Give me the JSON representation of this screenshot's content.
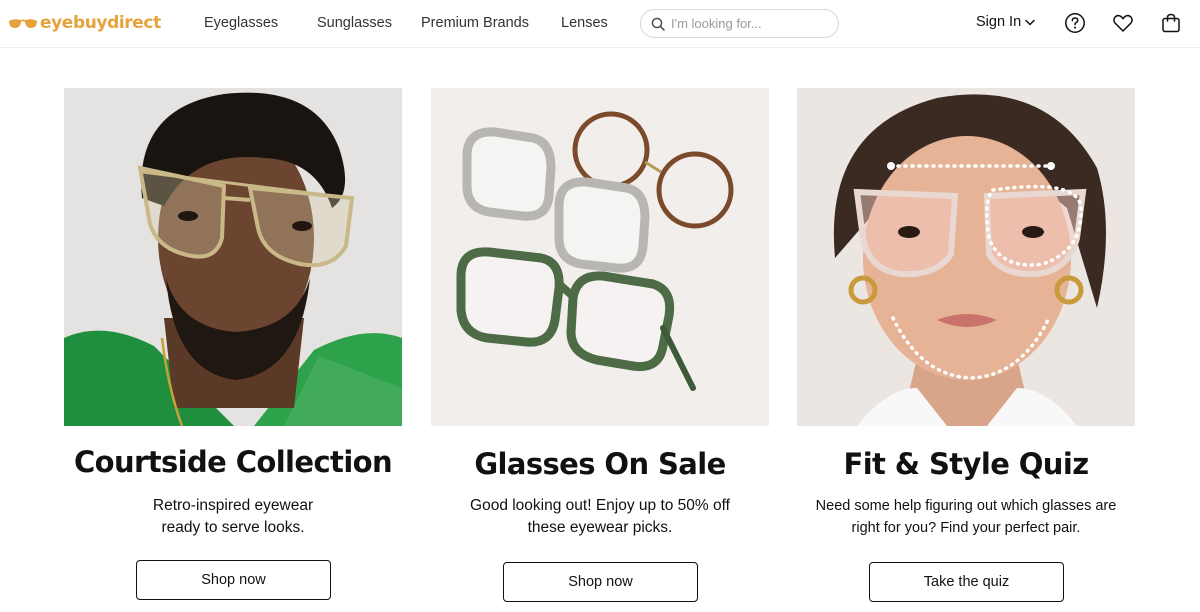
{
  "brand": {
    "logo_text": "eyebuydirect",
    "accent": "#e6a23c"
  },
  "nav": {
    "items": [
      {
        "label": "Eyeglasses"
      },
      {
        "label": "Sunglasses"
      },
      {
        "label": "Premium Brands"
      },
      {
        "label": "Lenses"
      }
    ]
  },
  "search": {
    "placeholder": "I'm looking for..."
  },
  "account": {
    "signin_label": "Sign In"
  },
  "icons": [
    "search-icon",
    "chevron-down-icon",
    "help-icon",
    "heart-icon",
    "cart-icon"
  ],
  "cards": [
    {
      "title": "Courtside Collection",
      "desc_line1": "Retro-inspired eyewear",
      "desc_line2": "ready to serve looks.",
      "button": "Shop now"
    },
    {
      "title": "Glasses On Sale",
      "desc_line1": "Good looking out! Enjoy up to 50% off",
      "desc_line2": "these eyewear picks.",
      "button": "Shop now"
    },
    {
      "title": "Fit & Style Quiz",
      "desc_line1": "Need some help figuring out which glasses are",
      "desc_line2": "right for you? Find your perfect pair.",
      "button": "Take the quiz"
    }
  ]
}
